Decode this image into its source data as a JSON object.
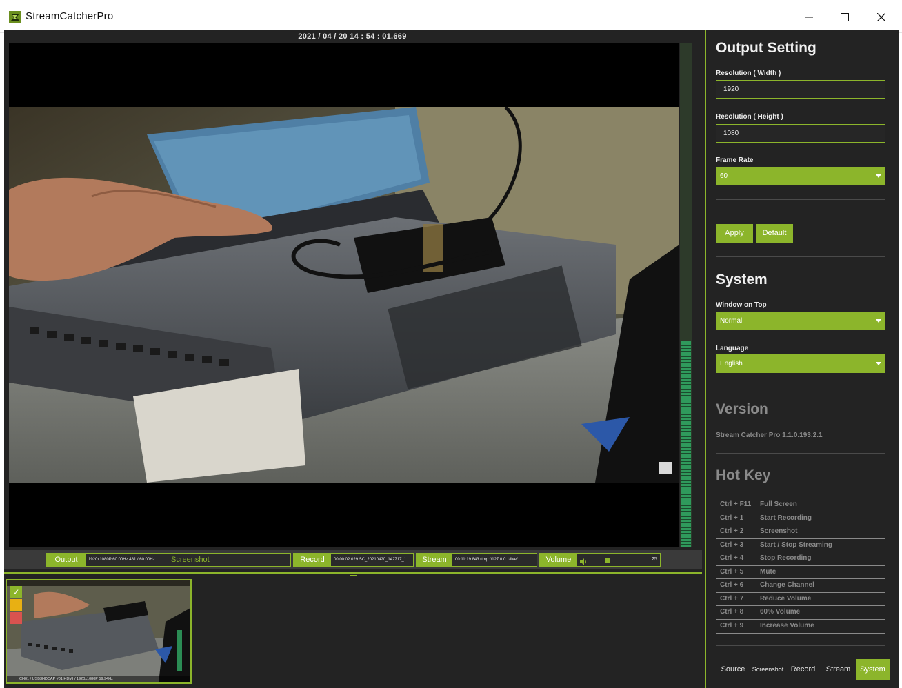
{
  "window": {
    "title": "StreamCatcherPro",
    "icon": "streamcatcher-logo-icon",
    "controls": {
      "minimize": "—",
      "maximize": "☐",
      "close": "✕"
    }
  },
  "preview": {
    "timestamp": "2021 / 04 / 20   14 : 54 : 01.669",
    "audio_level_fraction": 0.41
  },
  "status_bar": {
    "output_label": "Output",
    "output_info": "1920x1080P 60.00Hz    481 / 60.00Hz",
    "screenshot_label": "Screenshot",
    "record_label": "Record",
    "record_info": "00:00:02.029  SC_20210420_142717_1",
    "stream_label": "Stream",
    "stream_info": "00:11:19.843    rtmp://127.0.0.1/live/",
    "volume_label": "Volume",
    "volume_icon": "speaker-icon",
    "volume_value": "25",
    "volume_fraction": 0.25
  },
  "channel": {
    "caption": "CH01 / USB3HDCAP #01 HDMI / 1920x1080P 59.94Hz",
    "check_icon": "✓"
  },
  "output_setting": {
    "title": "Output Setting",
    "width_label": "Resolution ( Width )",
    "width_value": "1920",
    "height_label": "Resolution ( Height )",
    "height_value": "1080",
    "framerate_label": "Frame Rate",
    "framerate_value": "60",
    "apply_label": "Apply",
    "default_label": "Default"
  },
  "system": {
    "title": "System",
    "window_on_top_label": "Window on Top",
    "window_on_top_value": "Normal",
    "language_label": "Language",
    "language_value": "English"
  },
  "version": {
    "title": "Version",
    "text": "Stream Catcher Pro 1.1.0.193.2.1"
  },
  "hotkey": {
    "title": "Hot Key",
    "rows": [
      {
        "key": "Ctrl + F11",
        "action": "Full Screen"
      },
      {
        "key": "Ctrl + 1",
        "action": "Start Recording"
      },
      {
        "key": "Ctrl + 2",
        "action": "Screenshot"
      },
      {
        "key": "Ctrl + 3",
        "action": "Start / Stop Streaming"
      },
      {
        "key": "Ctrl + 4",
        "action": "Stop Recording"
      },
      {
        "key": "Ctrl + 5",
        "action": "Mute"
      },
      {
        "key": "Ctrl + 6",
        "action": "Change Channel"
      },
      {
        "key": "Ctrl + 7",
        "action": "Reduce Volume"
      },
      {
        "key": "Ctrl + 8",
        "action": "60% Volume"
      },
      {
        "key": "Ctrl + 9",
        "action": "Increase Volume"
      }
    ]
  },
  "tabs": {
    "source": "Source",
    "screenshot": "Screenshot",
    "record": "Record",
    "stream": "Stream",
    "system": "System",
    "active": "system"
  },
  "colors": {
    "accent": "#8cb52b",
    "background": "#232323",
    "record_status": "#e8b013",
    "stream_status": "#d9534f"
  }
}
